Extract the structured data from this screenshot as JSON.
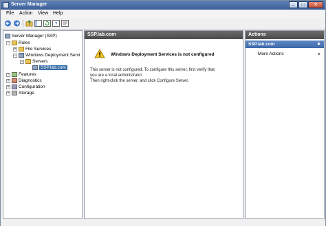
{
  "window": {
    "title": "Server Manager"
  },
  "menu": [
    "File",
    "Action",
    "View",
    "Help"
  ],
  "tree": {
    "root": "Server Manager (SSP)",
    "roles": "Roles",
    "file_services": "File Services",
    "wds": "Windows Deployment Servi",
    "servers": "Servers",
    "server_node": "SSP.lab.com",
    "features": "Features",
    "diagnostics": "Diagnostics",
    "configuration": "Configuration",
    "storage": "Storage"
  },
  "main": {
    "header": "SSP.lab.com",
    "warning_title": "Windows Deployment Services is not configured",
    "line1": "This server is not configured. To configure this server, first verify that",
    "line2": "you are a local administrator.",
    "line3": "Then right-click the server, and click Configure Server."
  },
  "actions": {
    "header": "Actions",
    "group": "SSP.lab.com",
    "item": "More Actions"
  },
  "icons": [
    "back-icon",
    "forward-icon",
    "up-icon",
    "show-hide-tree-icon",
    "refresh-icon",
    "help-icon",
    "properties-icon"
  ]
}
